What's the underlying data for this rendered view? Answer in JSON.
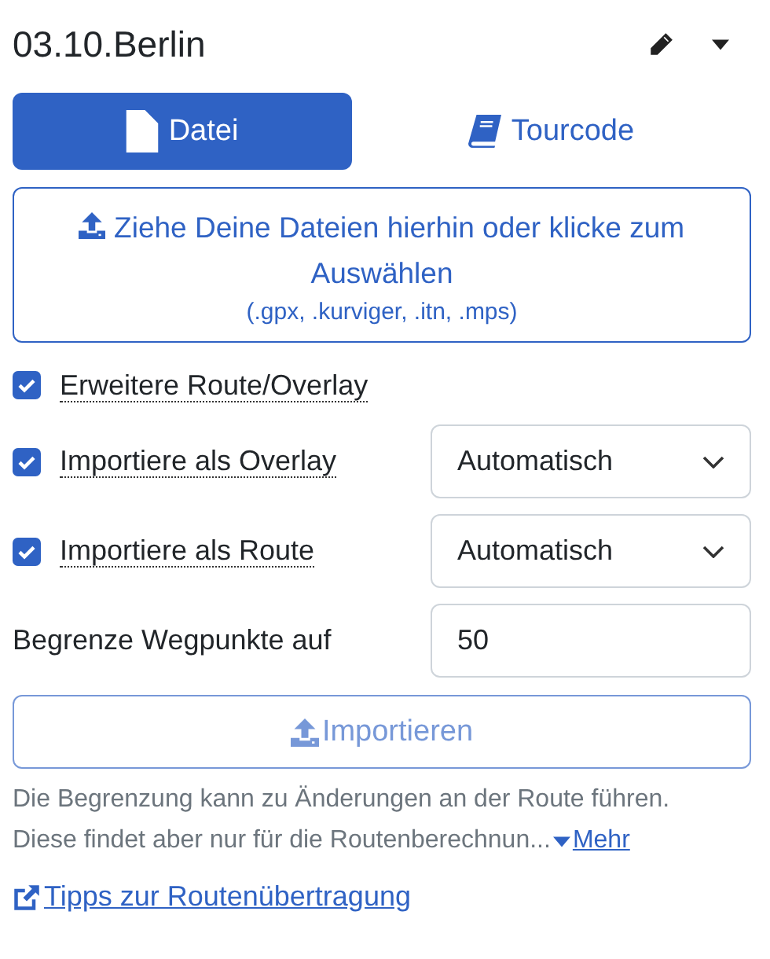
{
  "header": {
    "title": "03.10.Berlin"
  },
  "tabs": [
    {
      "label": "Datei",
      "kind": "file",
      "selected": true
    },
    {
      "label": "Tourcode",
      "kind": "book",
      "selected": false
    }
  ],
  "dropzone": {
    "text": "Ziehe Deine Dateien hierhin oder klicke zum Auswählen",
    "formats": "(.gpx, .kurviger, .itn, .mps)"
  },
  "options": [
    {
      "kind": "checkbox",
      "label": "Erweitere Route/Overlay",
      "checked": true
    },
    {
      "kind": "select",
      "label": "Importiere als Overlay",
      "checked": true,
      "value": "Automatisch"
    },
    {
      "kind": "select",
      "label": "Importiere als Route",
      "checked": true,
      "value": "Automatisch"
    },
    {
      "kind": "number",
      "label": "Begrenze Wegpunkte auf",
      "value": "50"
    }
  ],
  "import_button": {
    "label": "Importieren",
    "disabled": true
  },
  "help": {
    "line_1": "Die Begrenzung kann zu Änderungen an der Route führen.",
    "line_2": "Diese findet aber nur für die Routenberechnun...",
    "more": "Mehr"
  },
  "tips_link": "Tipps zur Routenübertragung"
}
